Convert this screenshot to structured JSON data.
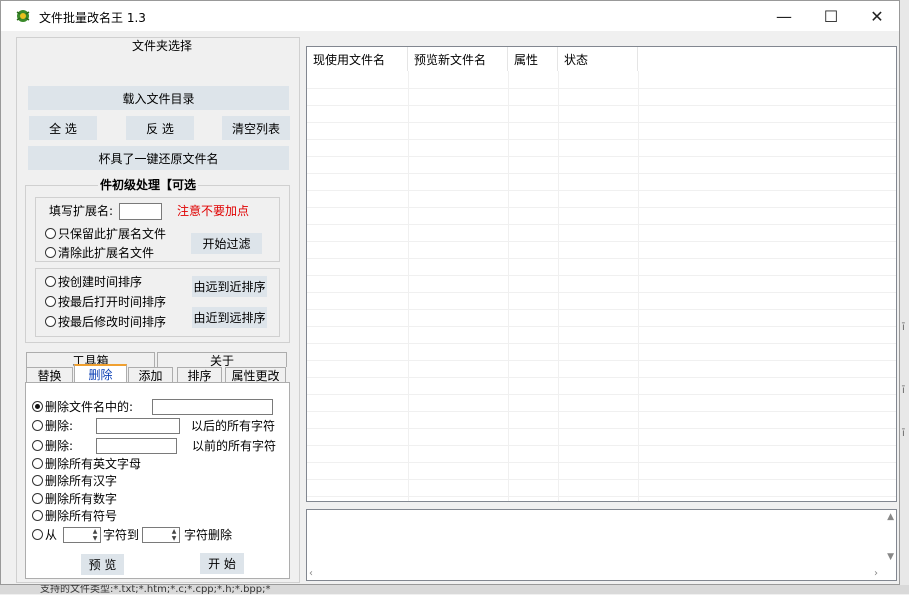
{
  "app": {
    "title": "文件批量改名王  1.3",
    "minimize": "—",
    "maximize": "☐",
    "close": "✕"
  },
  "folder_group": {
    "title": "文件夹选择",
    "load_button": "载入文件目录",
    "select_all": "全  选",
    "invert": "反  选",
    "clear_list": "清空列表",
    "restore_button": "杯具了一键还原文件名"
  },
  "filter_group": {
    "title": "件初级处理【可选",
    "ext_label": "填写扩展名:",
    "ext_value": "",
    "ext_hint": "注意不要加点",
    "keep_only": "只保留此扩展名文件",
    "remove_ext": "清除此扩展名文件",
    "start_filter": "开始过滤"
  },
  "sort_group": {
    "by_create": "按创建时间排序",
    "by_open": "按最后打开时间排序",
    "by_modify": "按最后修改时间排序",
    "far_to_near": "由远到近排序",
    "near_to_far": "由近到远排序"
  },
  "top_tabs": [
    "工具箱",
    "关于"
  ],
  "tabs": [
    "替换",
    "删除",
    "添加",
    "排序",
    "属性更改"
  ],
  "delete_tab": {
    "opt_contains": "删除文件名中的:",
    "opt_after": "删除:",
    "after_suffix": "以后的所有字符",
    "opt_before": "删除:",
    "before_suffix": "以前的所有字符",
    "opt_english": "删除所有英文字母",
    "opt_chinese": "删除所有汉字",
    "opt_digits": "删除所有数字",
    "opt_symbols": "删除所有符号",
    "opt_from": "从",
    "char_to": "字符到",
    "char_delete": "字符删除",
    "preview": "预  览",
    "start": "开  始"
  },
  "list": {
    "columns": [
      "现使用文件名",
      "预览新文件名",
      "属性",
      "状态"
    ]
  },
  "status_strip": "支持的文件类型:*.txt;*.htm;*.c;*.cpp;*.h;*.bpp;*"
}
